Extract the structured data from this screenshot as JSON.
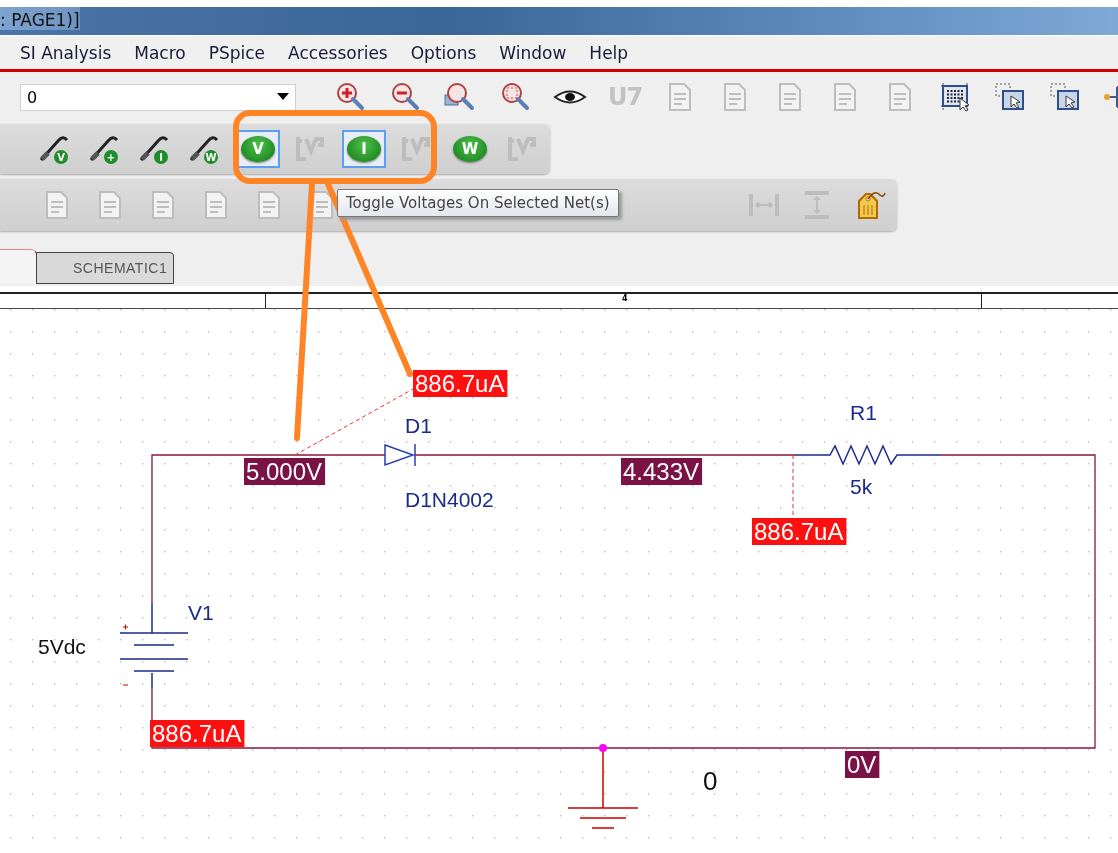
{
  "window": {
    "title": ": PAGE1)]"
  },
  "menu": [
    "SI Analysis",
    "Macro",
    "PSpice",
    "Accessories",
    "Options",
    "Window",
    "Help"
  ],
  "toolbar_1": {
    "combo_value": "0",
    "buttons": [
      {
        "kind": "zoom-in",
        "disabled": false
      },
      {
        "kind": "zoom-out",
        "disabled": false
      },
      {
        "kind": "zoom-area",
        "disabled": false
      },
      {
        "kind": "zoom-all",
        "disabled": false
      },
      {
        "kind": "eye",
        "disabled": false
      },
      {
        "kind": "text",
        "label": "U7",
        "disabled": true
      },
      {
        "kind": "document",
        "disabled": true
      },
      {
        "kind": "document",
        "disabled": true
      },
      {
        "kind": "document",
        "disabled": true
      },
      {
        "kind": "document",
        "disabled": true
      },
      {
        "kind": "document",
        "disabled": true
      },
      {
        "kind": "grid",
        "disabled": false
      },
      {
        "kind": "window",
        "disabled": false
      },
      {
        "kind": "window",
        "disabled": false
      },
      {
        "kind": "hierarchy",
        "disabled": false
      }
    ]
  },
  "toolbar_2": {
    "buttons": [
      {
        "kind": "probe",
        "badge": "V",
        "disabled": false
      },
      {
        "kind": "probe",
        "badge": "+",
        "disabled": false
      },
      {
        "kind": "probe",
        "badge": "I",
        "disabled": false
      },
      {
        "kind": "probe",
        "badge": "W",
        "disabled": false
      },
      {
        "kind": "toggle",
        "label": "V",
        "selected": true
      },
      {
        "kind": "marker",
        "disabled": true
      },
      {
        "kind": "toggle",
        "label": "I",
        "selected": true
      },
      {
        "kind": "marker",
        "disabled": true
      },
      {
        "kind": "toggle",
        "label": "W",
        "selected": false
      },
      {
        "kind": "marker",
        "disabled": true
      }
    ]
  },
  "toolbar_3": {
    "buttons": [
      {
        "kind": "document",
        "disabled": true
      },
      {
        "kind": "document",
        "disabled": true
      },
      {
        "kind": "document",
        "disabled": true
      },
      {
        "kind": "document",
        "disabled": true
      },
      {
        "kind": "document",
        "disabled": true
      },
      {
        "kind": "document",
        "disabled": true
      },
      {
        "kind": "gap"
      },
      {
        "kind": "h-space",
        "disabled": true
      },
      {
        "kind": "v-space",
        "disabled": true
      },
      {
        "kind": "tag",
        "disabled": false
      }
    ]
  },
  "tooltip": "Toggle Voltages On Selected Net(s)",
  "tabs": [
    {
      "label": "SCHEMATIC1",
      "selected": false
    }
  ],
  "ruler": {
    "marks": [
      "4"
    ]
  },
  "schematic": {
    "parts": [
      {
        "kind": "diode",
        "ref": "D1",
        "value": "D1N4002"
      },
      {
        "kind": "resistor",
        "ref": "R1",
        "value": "5k"
      },
      {
        "kind": "source",
        "ref": "V1",
        "value": "5Vdc"
      }
    ],
    "markers": [
      {
        "kind": "current",
        "text": "886.7uA"
      },
      {
        "kind": "voltage",
        "text": "5.000V"
      },
      {
        "kind": "voltage",
        "text": "4.433V"
      },
      {
        "kind": "current",
        "text": "886.7uA"
      },
      {
        "kind": "current",
        "text": "886.7uA"
      },
      {
        "kind": "voltage",
        "text": "0V"
      }
    ],
    "ground_label": "0"
  }
}
